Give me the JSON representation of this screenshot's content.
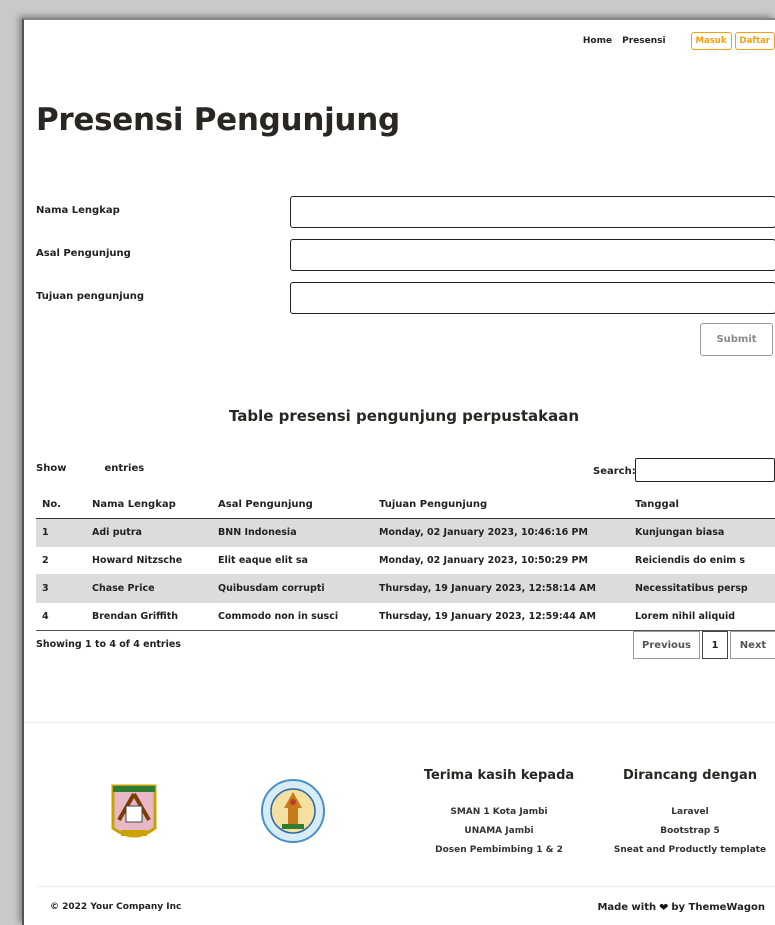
{
  "nav": {
    "links": [
      "Home",
      "Presensi"
    ],
    "login_label": "Masuk",
    "register_label": "Daftar"
  },
  "page_title": "Presensi Pengunjung",
  "form": {
    "fields": [
      {
        "label": "Nama Lengkap",
        "value": ""
      },
      {
        "label": "Asal Pengunjung",
        "value": ""
      },
      {
        "label": "Tujuan pengunjung",
        "value": ""
      }
    ],
    "submit_label": "Submit"
  },
  "table": {
    "title": "Table presensi pengunjung perpustakaan",
    "show_label": "Show",
    "entries_label": "entries",
    "search_label": "Search:",
    "columns": [
      "No.",
      "Nama Lengkap",
      "Asal Pengunjung",
      "Tujuan Pengunjung",
      "Tanggal"
    ],
    "rows": [
      [
        "1",
        "Adi putra",
        "BNN Indonesia",
        "Monday, 02 January 2023, 10:46:16 PM",
        "Kunjungan biasa"
      ],
      [
        "2",
        "Howard Nitzsche",
        "Elit eaque elit sa",
        "Monday, 02 January 2023, 10:50:29 PM",
        "Reiciendis do enim s"
      ],
      [
        "3",
        "Chase Price",
        "Quibusdam corrupti",
        "Thursday, 19 January 2023, 12:58:14 AM",
        "Necessitatibus persp"
      ],
      [
        "4",
        "Brendan Griffith",
        "Commodo non in susci",
        "Thursday, 19 January 2023, 12:59:44 AM",
        "Lorem nihil aliquid"
      ]
    ],
    "info": "Showing 1 to 4 of 4 entries",
    "pager": {
      "previous": "Previous",
      "current": "1",
      "next": "Next"
    }
  },
  "footer": {
    "thanks": {
      "heading": "Terima kasih kepada",
      "items": [
        "SMAN 1 Kota Jambi",
        "UNAMA Jambi",
        "Dosen Pembimbing 1 & 2"
      ]
    },
    "built": {
      "heading": "Dirancang dengan",
      "items": [
        "Laravel",
        "Bootstrap 5",
        "Sneat and Productly template"
      ]
    },
    "copyright": "© 2022 Your Company Inc",
    "made_with": "Made with",
    "made_by": "by ThemeWagon"
  },
  "icons": {
    "heart": "heart-icon",
    "logo_left": "school-crest-logo",
    "logo_right": "university-seal-logo"
  },
  "colors": {
    "accent": "#f0a010",
    "row_stripe": "#dcdcdc",
    "title": "#2a2622"
  }
}
